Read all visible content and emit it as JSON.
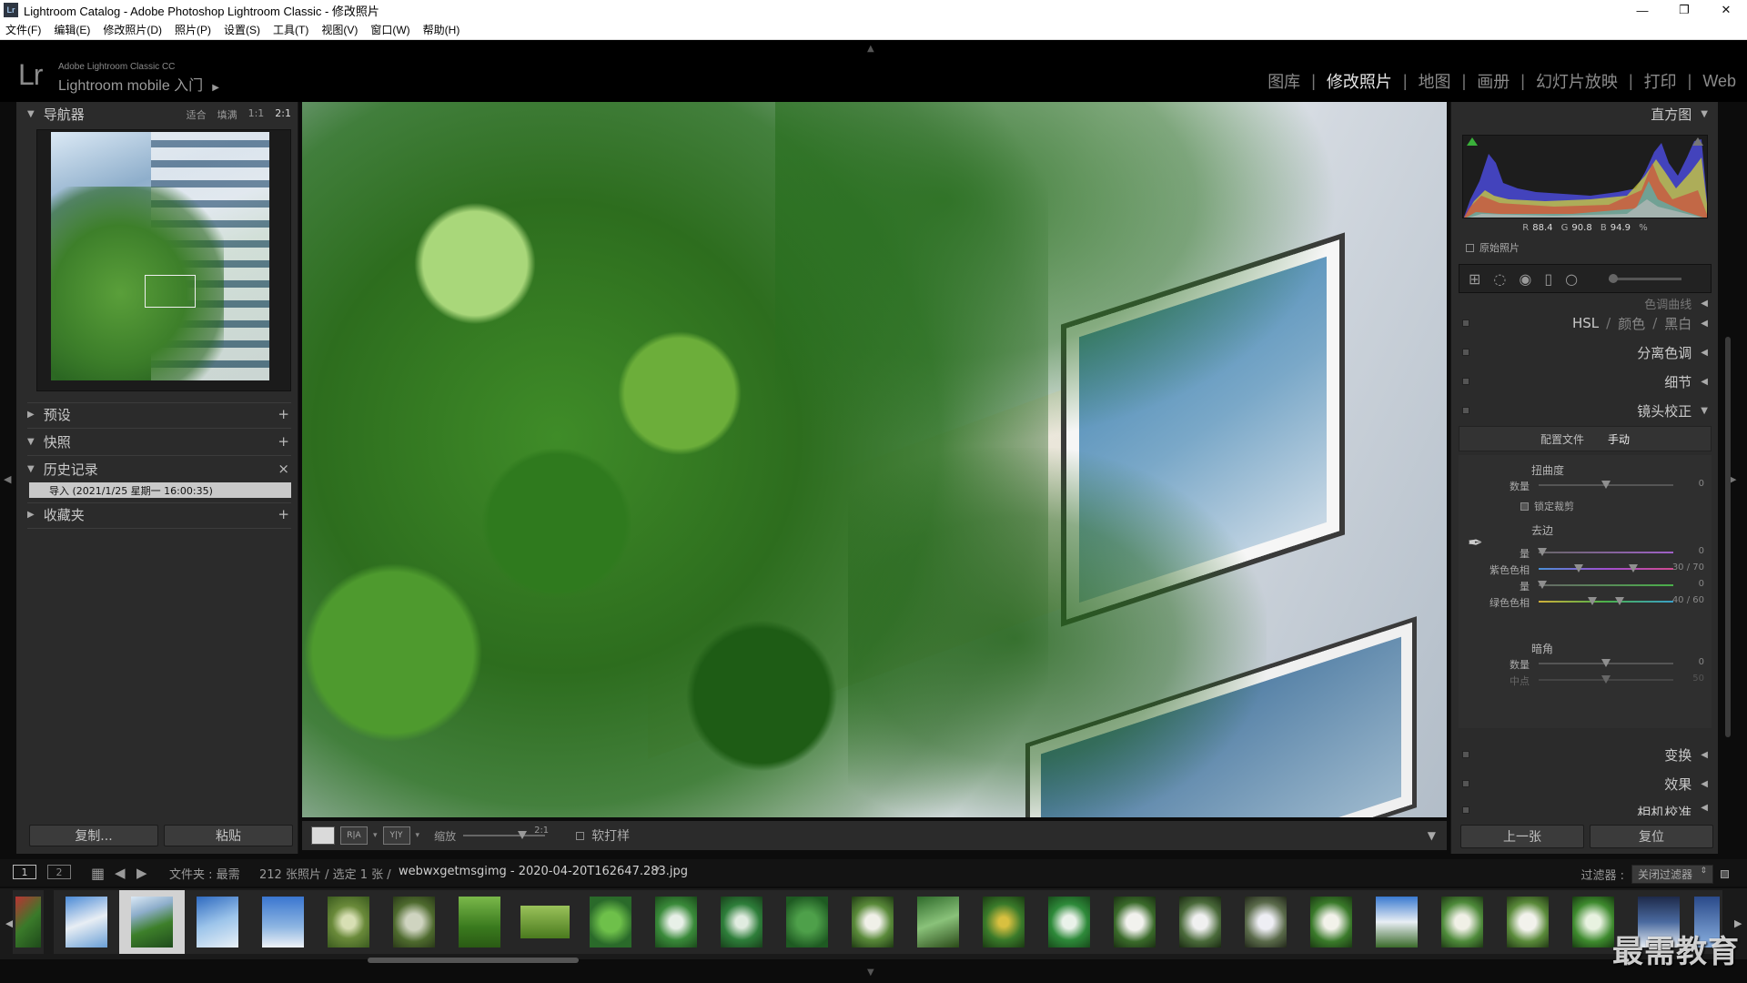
{
  "window": {
    "title": "Lightroom Catalog - Adobe Photoshop Lightroom Classic - 修改照片",
    "app_icon": "Lr",
    "controls": [
      "—",
      "❐",
      "✕"
    ]
  },
  "menu": [
    "文件(F)",
    "编辑(E)",
    "修改照片(D)",
    "照片(P)",
    "设置(S)",
    "工具(T)",
    "视图(V)",
    "窗口(W)",
    "帮助(H)"
  ],
  "identity": {
    "logo": "Lr",
    "small": "Adobe Lightroom Classic CC",
    "big": "Lightroom mobile 入门"
  },
  "modules": [
    {
      "label": "图库",
      "active": false
    },
    {
      "label": "修改照片",
      "active": true
    },
    {
      "label": "地图",
      "active": false
    },
    {
      "label": "画册",
      "active": false
    },
    {
      "label": "幻灯片放映",
      "active": false
    },
    {
      "label": "打印",
      "active": false
    },
    {
      "label": "Web",
      "active": false
    }
  ],
  "navigator": {
    "title": "导航器",
    "zoom_options": [
      "适合",
      "填满",
      "1:1",
      "2:1"
    ],
    "active_zoom": "2:1"
  },
  "left_sections": {
    "presets": "预设",
    "snapshots": "快照",
    "history": "历史记录",
    "history_item": "导入 (2021/1/25 星期一 16:00:35)",
    "collections": "收藏夹"
  },
  "left_buttons": {
    "copy": "复制...",
    "paste": "粘贴"
  },
  "right_panel": {
    "histogram_title": "直方图",
    "rgb": {
      "r_label": "R",
      "r": "88.4",
      "g_label": "G",
      "g": "90.8",
      "b_label": "B",
      "b": "94.9",
      "unit": "%"
    },
    "original_photo": "原始照片",
    "partial_header": "色调曲线",
    "hsl": {
      "hsl": "HSL",
      "color": "颜色",
      "bw": "黑白"
    },
    "split_toning": "分离色调",
    "detail": "细节",
    "lens_correction": "镜头校正",
    "lens_tabs": [
      "配置文件",
      "手动"
    ],
    "distortion": {
      "title": "扭曲度",
      "amount_label": "数量",
      "amount_value": "0",
      "constrain_crop": "锁定裁剪"
    },
    "defringe": {
      "title": "去边",
      "purple_amount_label": "量",
      "purple_amount_value": "0",
      "purple_hue_label": "紫色色相",
      "purple_hue_value": "30 / 70",
      "green_amount_label": "量",
      "green_amount_value": "0",
      "green_hue_label": "绿色色相",
      "green_hue_value": "40 / 60"
    },
    "vignetting": {
      "title": "暗角",
      "amount_label": "数量",
      "amount_value": "0",
      "midpoint_label": "中点",
      "midpoint_value": "50"
    },
    "transform": "变换",
    "effects": "效果",
    "camera_calibration": "相机校准",
    "prev_button": "上一张",
    "reset_button": "复位"
  },
  "toolbar": {
    "zoom_label": "缩放",
    "zoom_value": "2:1",
    "softproof": "软打样"
  },
  "filmbar": {
    "screen1": "1",
    "screen2": "2",
    "source": "文件夹 : 最需",
    "count": "212 张照片 / 选定 1 张 /",
    "filename": "webwxgetmsgimg - 2020-04-20T162647.283.jpg",
    "filter_label": "过滤器 :",
    "filter_value": "关闭过滤器"
  },
  "watermark": "最需教育",
  "colors": {
    "panel_bg": "#2b2b2b",
    "chrome_bg": "#0c0c0c",
    "highlight": "#d2d2d2"
  }
}
